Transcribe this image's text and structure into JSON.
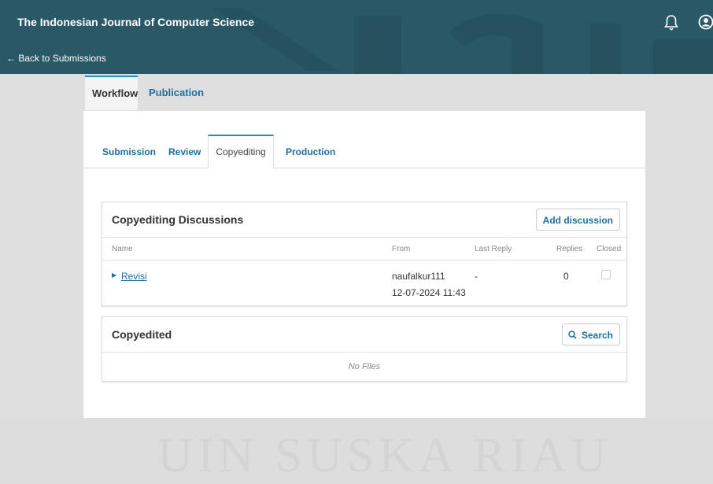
{
  "header": {
    "site_title": "The Indonesian Journal of Computer Science",
    "back_link": "← Back to Submissions"
  },
  "watermark": "UIN SUSKA RIAU",
  "main_tabs": [
    {
      "label": "Workflow",
      "active": true
    },
    {
      "label": "Publication",
      "active": false
    }
  ],
  "sub_tabs": [
    {
      "label": "Submission",
      "active": false
    },
    {
      "label": "Review",
      "active": false
    },
    {
      "label": "Copyediting",
      "active": true
    },
    {
      "label": "Production",
      "active": false
    }
  ],
  "discussions": {
    "title": "Copyediting Discussions",
    "add_button": "Add discussion",
    "columns": {
      "name": "Name",
      "from": "From",
      "last_reply": "Last Reply",
      "replies": "Replies",
      "closed": "Closed"
    },
    "rows": [
      {
        "name": "Revisi",
        "from_user": "naufalkur111",
        "from_date": "12-07-2024 11:43",
        "last_reply": "-",
        "replies": "0",
        "closed": false
      }
    ]
  },
  "copyedited": {
    "title": "Copyedited",
    "search_button": "Search",
    "empty_text": "No Files"
  },
  "colors": {
    "header_bg": "#2a5866",
    "link": "#1e6f9f",
    "accent": "#2a8bbd"
  }
}
